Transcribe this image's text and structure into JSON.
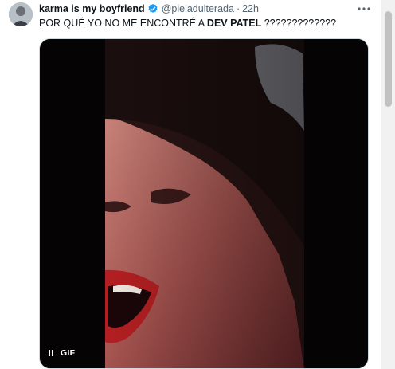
{
  "tweet": {
    "display_name": "karma is my boyfriend",
    "verified_icon": "verified-badge-icon",
    "handle": "@pieladulterada",
    "separator": "·",
    "time": "22h",
    "more_icon": "more-options-icon",
    "text_before": "POR QUÉ YO NO ME ENCONTRÉ A ",
    "text_bold": "DEV PATEL",
    "text_after": " ?????????????"
  },
  "media": {
    "pause_icon": "pause-icon",
    "badge": "GIF"
  },
  "colors": {
    "text": "#0f1419",
    "secondary": "#536471",
    "verified": "#1d9bf0",
    "media_border": "#cfd9de"
  }
}
